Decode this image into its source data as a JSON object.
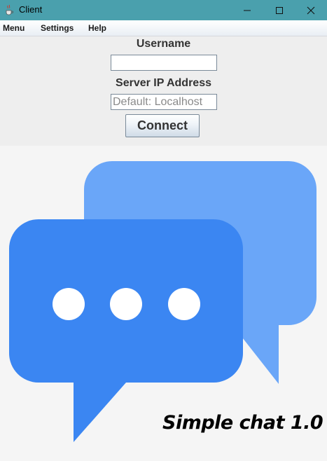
{
  "window": {
    "title": "Client",
    "icons": {
      "app": "java-cup-icon",
      "minimize": "minimize-icon",
      "maximize": "maximize-icon",
      "close": "close-icon"
    },
    "colors": {
      "titlebar": "#4aa0ad"
    }
  },
  "menubar": {
    "items": [
      {
        "label": "Menu"
      },
      {
        "label": "Settings"
      },
      {
        "label": "Help"
      }
    ]
  },
  "form": {
    "username_label": "Username",
    "username_value": "",
    "server_label": "Server IP Address",
    "server_value": "",
    "server_placeholder": "Default: Localhost",
    "connect_label": "Connect"
  },
  "illustration": {
    "icon": "chat-bubbles-icon",
    "caption": "Simple chat 1.0",
    "colors": {
      "back_bubble": "#6aa6f8",
      "front_bubble": "#3b86f2",
      "dots": "#ffffff"
    }
  }
}
